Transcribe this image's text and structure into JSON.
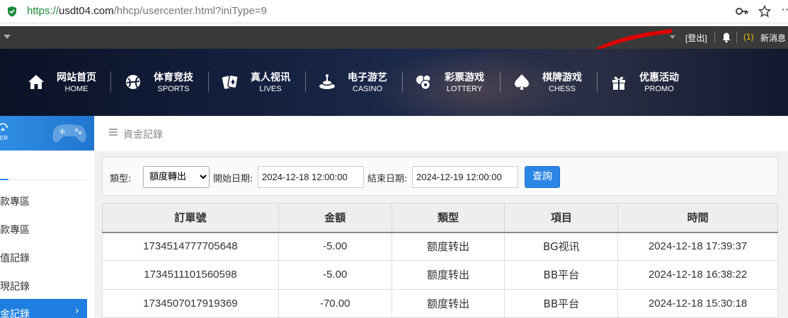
{
  "browser": {
    "url_proto": "https://",
    "url_host": "usdt04.com",
    "url_path": "/hhcp/usercenter.html?iniType=9"
  },
  "userbar": {
    "logout_label": "[登出]",
    "message_count": "(1)",
    "message_label": "新消息"
  },
  "nav": {
    "items": [
      {
        "cn": "网站首页",
        "en": "HOME",
        "icon": "home-icon"
      },
      {
        "cn": "体育竞技",
        "en": "SPORTS",
        "icon": "soccer-ball-icon"
      },
      {
        "cn": "真人视讯",
        "en": "LIVES",
        "icon": "cards-icon"
      },
      {
        "cn": "电子游艺",
        "en": "CASINO",
        "icon": "slot-machine-icon"
      },
      {
        "cn": "彩票游戏",
        "en": "LOTTERY",
        "icon": "lottery-balls-icon"
      },
      {
        "cn": "棋牌游戏",
        "en": "CHESS",
        "icon": "spade-icon"
      },
      {
        "cn": "优惠活动",
        "en": "PROMO",
        "icon": "gift-icon"
      }
    ]
  },
  "sidebar": {
    "banner_text": "ER",
    "items": [
      {
        "label": "款專區"
      },
      {
        "label": "款專區"
      },
      {
        "label": "值記錄"
      },
      {
        "label": "現記錄"
      },
      {
        "label": "金記錄",
        "active": true
      }
    ],
    "active_arrow": "›"
  },
  "main": {
    "breadcrumb": "資金記錄",
    "filter": {
      "type_label": "類型:",
      "type_value": "額度轉出",
      "start_label": "開始日期:",
      "start_value": "2024-12-18 12:00:00",
      "end_label": "結束日期:",
      "end_value": "2024-12-19 12:00:00",
      "query_label": "查詢"
    },
    "table": {
      "headers": [
        "訂單號",
        "金額",
        "類型",
        "項目",
        "時間"
      ],
      "rows": [
        [
          "1734514777705648",
          "-5.00",
          "额度转出",
          "BG视讯",
          "2024-12-18 17:39:37"
        ],
        [
          "1734511101560598",
          "-5.00",
          "额度转出",
          "BB平台",
          "2024-12-18 16:38:22"
        ],
        [
          "1734507017919369",
          "-70.00",
          "额度转出",
          "BB平台",
          "2024-12-18 15:30:18"
        ]
      ]
    }
  },
  "colors": {
    "accent": "#2c86e6",
    "userbar_bg": "#3a3a3a",
    "message_count": "#e6c200",
    "annotation_red": "#e00000"
  }
}
